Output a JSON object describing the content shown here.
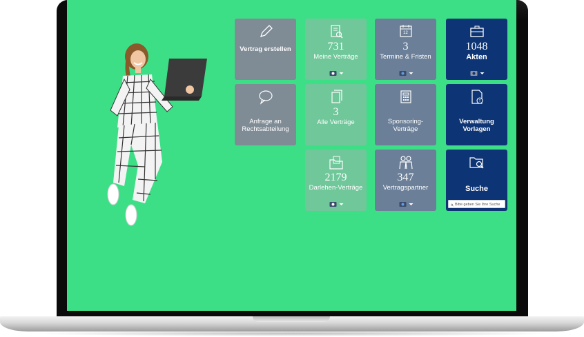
{
  "tiles": {
    "vertrag_erstellen": {
      "label": "Vertrag erstellen",
      "icon": "pencil-icon"
    },
    "meine_vertraege": {
      "count": "731",
      "label": "Meine Verträge",
      "icon": "document-search-icon"
    },
    "termine_fristen": {
      "count": "3",
      "label": "Termine & Fristen",
      "icon": "calendar-icon",
      "calendar_day": "12"
    },
    "akten": {
      "count": "1048",
      "label": "Akten",
      "icon": "briefcase-icon"
    },
    "anfrage": {
      "label": "Anfrage an Rechtsabteilung",
      "icon": "speech-bubble-icon"
    },
    "alle_vertraege": {
      "count": "3",
      "label": "Alle Verträge",
      "icon": "documents-icon"
    },
    "sponsoring": {
      "label": "Sponsoring-Verträge",
      "icon": "calculator-icon"
    },
    "verwaltung": {
      "label": "Verwaltung Vorlagen",
      "icon": "template-document-icon"
    },
    "darlehen": {
      "count": "2179",
      "label": "Darlehen-Verträge",
      "icon": "folder-document-icon"
    },
    "vertragspartner": {
      "count": "347",
      "label": "Vertragspartner",
      "icon": "people-icon"
    },
    "suche": {
      "label": "Suche",
      "icon": "folder-search-icon",
      "placeholder": "Bitte geben Sie Ihre Suche"
    }
  },
  "colors": {
    "screen_bg": "#3ddf86",
    "tile_gray": "#7f8b95",
    "tile_green": "#6fc79a",
    "tile_slate": "#6b7f98",
    "tile_navy": "#0d3474"
  }
}
